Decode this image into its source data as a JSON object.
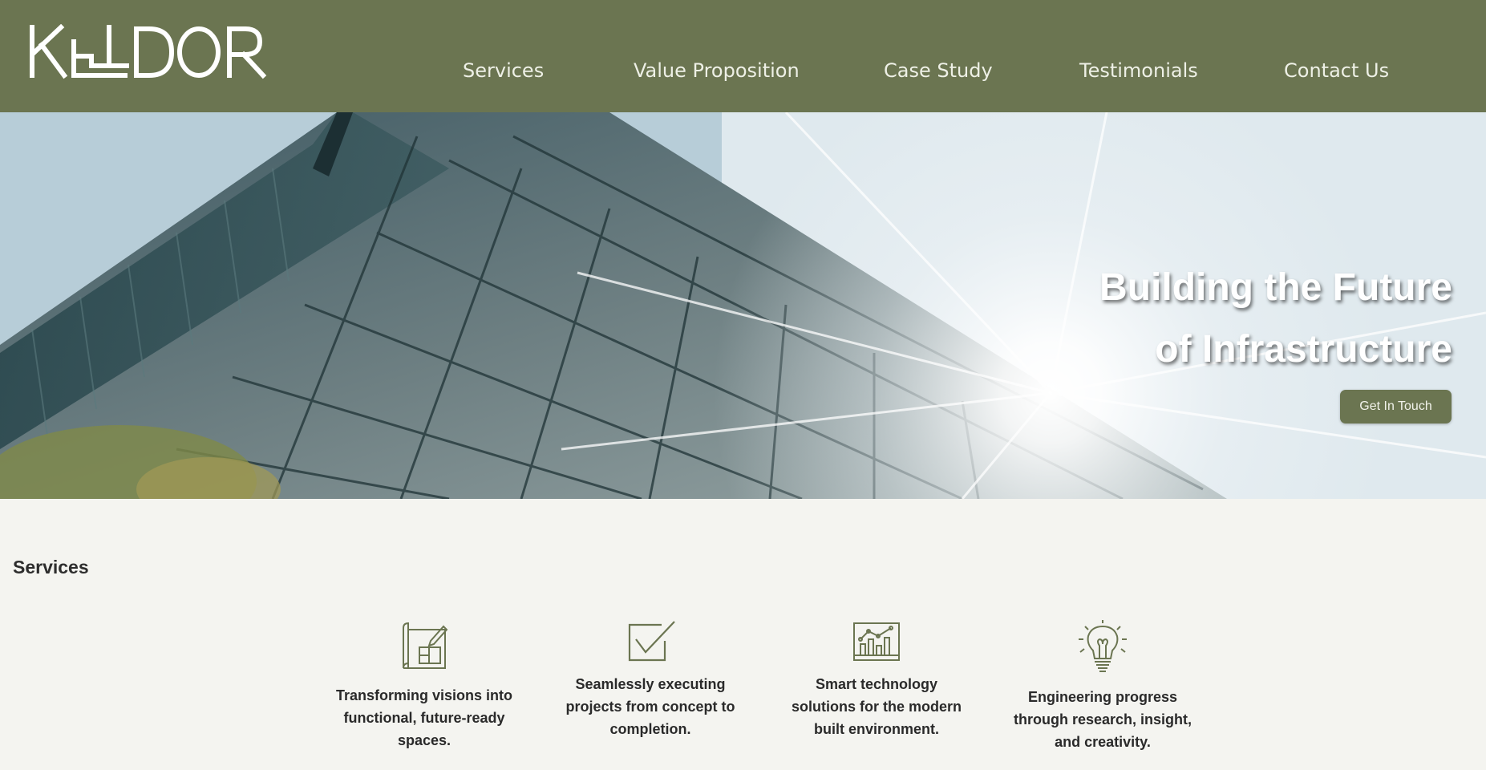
{
  "brand": {
    "logo_text": "KELDOR",
    "header_color": "#6b7551"
  },
  "nav": {
    "items": [
      {
        "label": "Services"
      },
      {
        "label": "Value Proposition"
      },
      {
        "label": "Case Study"
      },
      {
        "label": "Testimonials"
      },
      {
        "label": "Contact Us"
      }
    ]
  },
  "hero": {
    "title_line1": "Building the Future",
    "title_line2": "of Infrastructure",
    "cta_label": "Get In Touch",
    "image": "glass-building-facade-with-sun-flare"
  },
  "services": {
    "heading": "Services",
    "items": [
      {
        "icon": "blueprint-icon",
        "text": "Transforming visions into functional, future-ready spaces."
      },
      {
        "icon": "checkbox-icon",
        "text": "Seamlessly executing projects from concept to completion."
      },
      {
        "icon": "analytics-chart-icon",
        "text": "Smart technology solutions for the modern built environment."
      },
      {
        "icon": "lightbulb-icon",
        "text": "Engineering progress through research, insight, and creativity."
      }
    ]
  }
}
